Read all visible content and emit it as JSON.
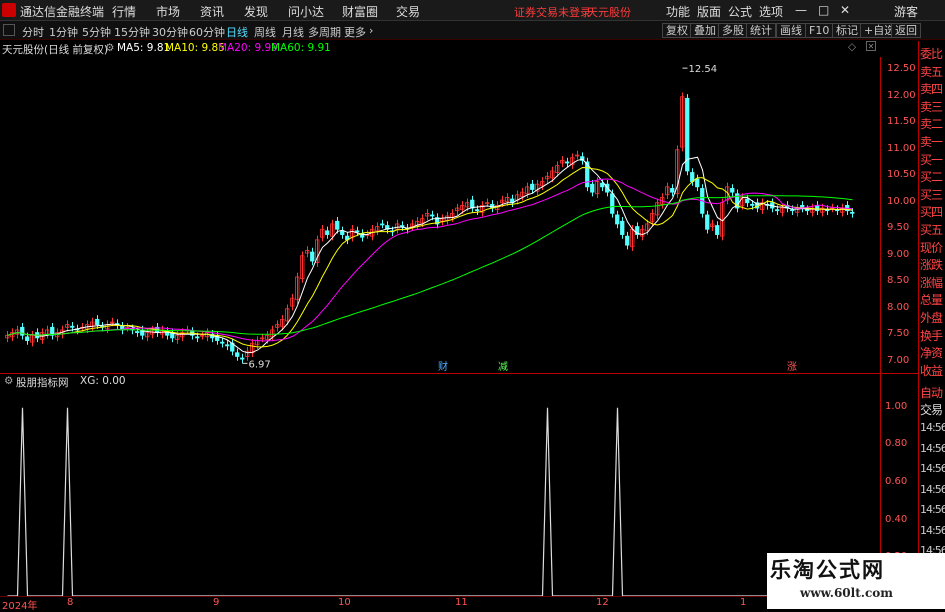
{
  "menubar": {
    "app_title": "通达信金融终端",
    "items": [
      "行情",
      "市场",
      "资讯",
      "发现",
      "问小达",
      "财富圈",
      "交易"
    ],
    "status": "证券交易未登录",
    "stock": "天元股份",
    "right_items": [
      "功能",
      "版面",
      "公式",
      "选项"
    ],
    "window_controls": [
      "—",
      "□",
      "✕"
    ],
    "user": "游客"
  },
  "toolbar": {
    "periods": [
      "分时",
      "1分钟",
      "5分钟",
      "15分钟",
      "30分钟",
      "60分钟",
      "日线",
      "周线",
      "月线",
      "多周期",
      "更多"
    ],
    "active_period": "日线",
    "right_buttons": [
      "复权",
      "叠加",
      "多股",
      "统计",
      "画线",
      "F10",
      "标记",
      "+自选",
      "返回"
    ]
  },
  "info": {
    "title": "天元股份(日线 前复权)",
    "ma5": "MA5: 9.81",
    "ma10": "MA10: 9.85",
    "ma20": "MA20: 9.99",
    "ma60": "MA60: 9.91"
  },
  "colors": {
    "ma5": "#ffffff",
    "ma10": "#ffff00",
    "ma20": "#ff00ff",
    "ma60": "#00ff00",
    "up": "#ff3333",
    "down": "#54ffff",
    "accent": "#ff3b3b"
  },
  "price_scale": [
    "12.50",
    "12.00",
    "11.50",
    "11.00",
    "10.50",
    "10.00",
    "9.50",
    "9.00",
    "8.50",
    "8.00",
    "7.50",
    "7.00"
  ],
  "annotations": {
    "high": "12.54",
    "low": "6.97"
  },
  "markers": [
    "财",
    "减",
    "涨"
  ],
  "indicator": {
    "name": "股朋指标网",
    "xg": "XG: 0.00"
  },
  "ind_scale": [
    "1.00",
    "0.80",
    "0.60",
    "0.40",
    "0.20"
  ],
  "dates": [
    "2024年",
    "8",
    "9",
    "10",
    "11",
    "12",
    "1"
  ],
  "right_panel": {
    "labels": [
      "委比",
      "卖五",
      "卖四",
      "卖三",
      "卖二",
      "卖一",
      "买一",
      "买二",
      "买三",
      "买四",
      "买五",
      "现价",
      "涨跌",
      "涨幅",
      "总量",
      "外盘",
      "换手",
      "净资",
      "收益"
    ],
    "auto": [
      "自动",
      "交易"
    ],
    "times": [
      "14:56",
      "14:56",
      "14:56",
      "14:56",
      "14:56",
      "14:56",
      "14:56",
      "14:56"
    ]
  },
  "watermark": {
    "title": "乐淘公式网",
    "url": "www.60lt.com"
  },
  "chart_data": {
    "type": "candlestick",
    "x": [
      1,
      2,
      3,
      4,
      5,
      6,
      7,
      8,
      9,
      10,
      11,
      12,
      13,
      14,
      15,
      16,
      17,
      18,
      19,
      20,
      21,
      22,
      23,
      24,
      25,
      26,
      27,
      28,
      29,
      30,
      31,
      32,
      33,
      34,
      35,
      36,
      37,
      38,
      39,
      40,
      41,
      42,
      43,
      44,
      45,
      46,
      47,
      48,
      49,
      50,
      51,
      52,
      53,
      54,
      55,
      56,
      57,
      58,
      59,
      60,
      61,
      62,
      63,
      64,
      65,
      66,
      67,
      68,
      69,
      70,
      71,
      72,
      73,
      74,
      75,
      76,
      77,
      78,
      79,
      80,
      81,
      82,
      83,
      84,
      85,
      86,
      87,
      88,
      89,
      90,
      91,
      92,
      93,
      94,
      95,
      96,
      97,
      98,
      99,
      100,
      101,
      102,
      103,
      104,
      105,
      106,
      107,
      108,
      109,
      110,
      111,
      112,
      113,
      114,
      115,
      116,
      117,
      118,
      119,
      120,
      121,
      122,
      123,
      124,
      125,
      126,
      127,
      128,
      129,
      130,
      131,
      132,
      133,
      134,
      135,
      136,
      137,
      138,
      139,
      140,
      141,
      142,
      143,
      144,
      145,
      146,
      147,
      148,
      149,
      150,
      151,
      152,
      153,
      154,
      155,
      156,
      157,
      158,
      159,
      160,
      161,
      162,
      163,
      164,
      165,
      166,
      167,
      168,
      169,
      170
    ],
    "close": [
      7.5,
      7.55,
      7.6,
      7.5,
      7.4,
      7.5,
      7.45,
      7.55,
      7.6,
      7.5,
      7.55,
      7.6,
      7.7,
      7.65,
      7.6,
      7.65,
      7.7,
      7.75,
      7.7,
      7.65,
      7.7,
      7.75,
      7.7,
      7.6,
      7.65,
      7.6,
      7.55,
      7.5,
      7.55,
      7.6,
      7.55,
      7.6,
      7.5,
      7.45,
      7.5,
      7.55,
      7.6,
      7.5,
      7.45,
      7.5,
      7.55,
      7.45,
      7.4,
      7.35,
      7.3,
      7.2,
      7.1,
      7.05,
      7.2,
      7.35,
      7.4,
      7.45,
      7.5,
      7.6,
      7.7,
      7.8,
      8.0,
      8.2,
      8.6,
      9.0,
      9.1,
      8.9,
      9.3,
      9.5,
      9.4,
      9.6,
      9.5,
      9.4,
      9.3,
      9.5,
      9.45,
      9.35,
      9.4,
      9.5,
      9.55,
      9.6,
      9.5,
      9.45,
      9.6,
      9.55,
      9.5,
      9.6,
      9.65,
      9.7,
      9.8,
      9.75,
      9.6,
      9.7,
      9.75,
      9.8,
      9.9,
      9.95,
      10.0,
      9.9,
      9.85,
      9.95,
      10.0,
      9.9,
      9.95,
      10.05,
      10.1,
      10.0,
      10.15,
      10.2,
      10.3,
      10.25,
      10.35,
      10.4,
      10.5,
      10.6,
      10.7,
      10.8,
      10.75,
      10.85,
      10.9,
      10.8,
      10.3,
      10.2,
      10.4,
      10.3,
      10.2,
      9.8,
      9.6,
      9.4,
      9.2,
      9.5,
      9.4,
      9.5,
      9.6,
      9.8,
      10.0,
      10.1,
      10.3,
      10.2,
      11.0,
      12.0,
      10.6,
      10.4,
      10.3,
      9.8,
      9.5,
      9.6,
      9.4,
      10.0,
      10.3,
      10.2,
      9.9,
      10.1,
      10.0,
      9.95,
      9.9,
      10.0,
      9.95,
      9.9,
      9.85,
      9.9,
      9.9,
      9.85,
      9.9,
      9.9,
      9.85,
      9.9,
      9.85,
      9.9,
      9.85,
      9.9,
      9.85,
      9.9,
      9.85,
      9.8
    ],
    "annotations": {
      "max": 12.54,
      "min": 6.97
    },
    "series": [
      {
        "name": "MA5",
        "values": [
          9.81
        ]
      },
      {
        "name": "MA10",
        "values": [
          9.85
        ]
      },
      {
        "name": "MA20",
        "values": [
          9.99
        ]
      },
      {
        "name": "MA60",
        "values": [
          9.91
        ]
      }
    ],
    "ylim": [
      6.75,
      12.75
    ],
    "y_ticks": [
      7.0,
      7.5,
      8.0,
      8.5,
      9.0,
      9.5,
      10.0,
      10.5,
      11.0,
      11.5,
      12.0,
      12.5
    ],
    "indicator": {
      "name": "XG",
      "spikes_at": [
        3,
        12,
        108,
        122
      ],
      "values_max": 1.0,
      "ylim": [
        0,
        1.1
      ]
    }
  }
}
